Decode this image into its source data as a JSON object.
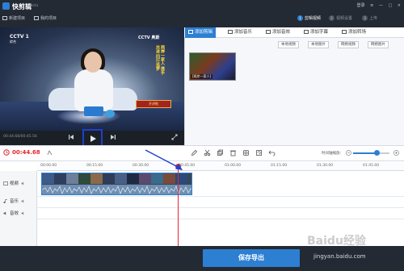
{
  "app": {
    "title": "快剪辑",
    "badge": "Beta",
    "new_project": "新建项目",
    "my_projects": "我的项目",
    "window_controls": [
      "登录",
      "≡",
      "—",
      "□",
      "×"
    ]
  },
  "steps": [
    {
      "num": "1",
      "label": "剪辑视频",
      "active": true
    },
    {
      "num": "2",
      "label": "视频设置",
      "active": false
    },
    {
      "num": "3",
      "label": "上传",
      "active": false
    }
  ],
  "player": {
    "time_readout": "00:44.68/00:45.56",
    "overlay_left": "CCTV 1",
    "overlay_left_sub": "综合",
    "overlay_right": "CCTV 奥斯",
    "caption_vertical": "两岸一家人 携手共进 同行追梦",
    "banner": "开讲啦"
  },
  "tabs": [
    {
      "label": "添加剪辑",
      "icon": "film-icon",
      "active": true
    },
    {
      "label": "添加音乐",
      "icon": "music-icon",
      "active": false
    },
    {
      "label": "添加音效",
      "icon": "sound-effect-icon",
      "active": false
    },
    {
      "label": "添加字幕",
      "icon": "text-icon",
      "active": false
    },
    {
      "label": "添加转场",
      "icon": "transition-icon",
      "active": false
    }
  ],
  "panel_actions": [
    "本地视频",
    "本地图片",
    "网络视频",
    "网络图片"
  ],
  "media": {
    "thumb_label": "[两岸一家人]"
  },
  "toolbar": {
    "current_time": "00:44.68",
    "zoom_label": "时间轴缩放:",
    "zoom_level": 0.65,
    "icons": [
      "pen-icon",
      "scissors-icon",
      "copy-icon",
      "delete-icon",
      "crop-icon",
      "rotate-icon",
      "undo-icon"
    ]
  },
  "timeline": {
    "ticks": [
      "00:00.00",
      "00:15.00",
      "00:30.00",
      "00:45.00",
      "01:00.00",
      "01:15.00",
      "01:30.00",
      "01:45.00"
    ],
    "tracks": [
      {
        "label": "视频",
        "icon": "video-track-icon"
      },
      {
        "label": "音乐",
        "icon": "music-track-icon"
      },
      {
        "label": "音效",
        "icon": "sound-track-icon"
      }
    ],
    "playhead_time": "00:44.68"
  },
  "footer": {
    "export_label": "保存导出",
    "watermark": "Baidu经验",
    "url": "jingyan.baidu.com"
  },
  "colors": {
    "accent": "#2d7fd2",
    "dark": "#232a33",
    "playhead": "#e4272f",
    "annotation": "#1f3fd0"
  }
}
